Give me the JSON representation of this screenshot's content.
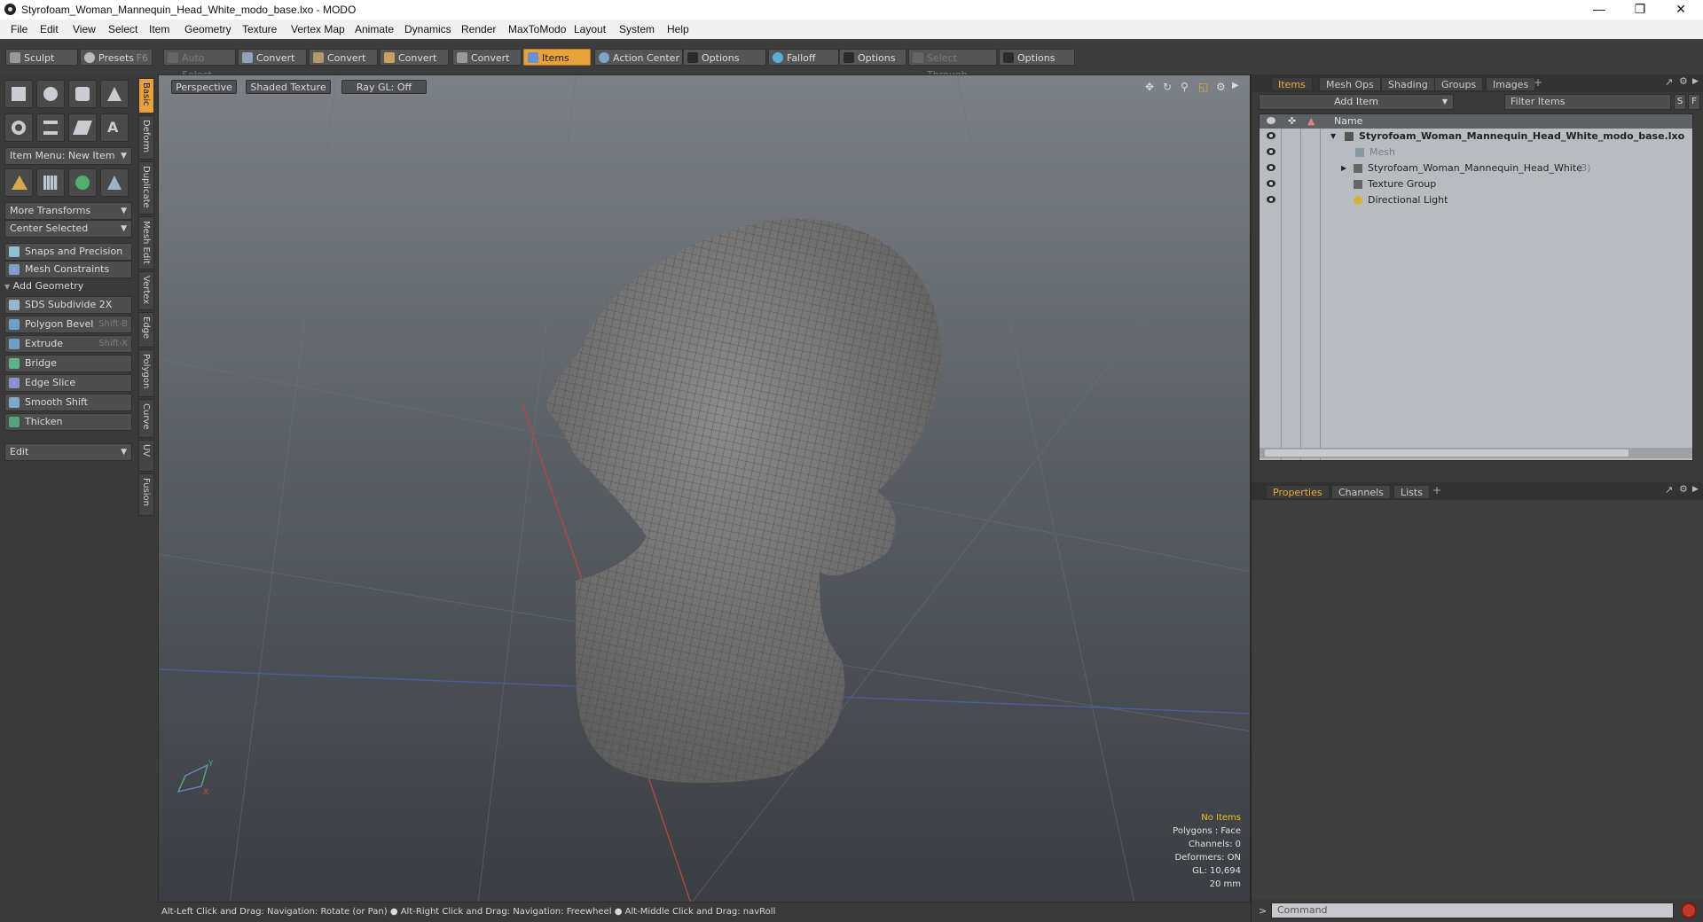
{
  "window": {
    "title": "Styrofoam_Woman_Mannequin_Head_White_modo_base.lxo - MODO"
  },
  "menu": [
    "File",
    "Edit",
    "View",
    "Select",
    "Item",
    "Geometry",
    "Texture",
    "Vertex Map",
    "Animate",
    "Dynamics",
    "Render",
    "MaxToModo",
    "Layout",
    "System",
    "Help"
  ],
  "toolbar": {
    "sculpt": "Sculpt",
    "presets": "Presets",
    "presets_key": "F6",
    "auto_select": "Auto Select",
    "convert1": "Convert",
    "convert2": "Convert",
    "convert3": "Convert",
    "convert4": "Convert",
    "items": "Items",
    "action_center": "Action Center",
    "options1": "Options",
    "falloff": "Falloff",
    "options2": "Options",
    "select_through": "Select Through",
    "options3": "Options"
  },
  "left": {
    "item_menu": "Item Menu: New Item",
    "more_transforms": "More Transforms",
    "center_selected": "Center Selected",
    "snaps": "Snaps and Precision",
    "mesh_constraints": "Mesh Constraints",
    "add_geometry": "Add Geometry",
    "sds": "SDS Subdivide 2X",
    "polygon_bevel": "Polygon Bevel",
    "polygon_bevel_key": "Shift-B",
    "extrude": "Extrude",
    "extrude_key": "Shift-X",
    "bridge": "Bridge",
    "edge_slice": "Edge Slice",
    "smooth_shift": "Smooth Shift",
    "thicken": "Thicken",
    "edit": "Edit",
    "side_tabs": [
      "Basic",
      "Deform",
      "Duplicate",
      "Mesh Edit",
      "Vertex",
      "Edge",
      "Polygon",
      "Curve",
      "UV",
      "Fusion"
    ]
  },
  "viewport": {
    "perspective": "Perspective",
    "shading": "Shaded Texture",
    "raygl": "Ray GL: Off",
    "info": {
      "no_items": "No Items",
      "polygons": "Polygons : Face",
      "channels": "Channels: 0",
      "deformers": "Deformers: ON",
      "gl": "GL: 10,694",
      "scale": "20 mm"
    },
    "axis_y": "Y",
    "axis_x": "X"
  },
  "status": "Alt-Left Click and Drag: Navigation: Rotate (or Pan) ●  Alt-Right Click and Drag: Navigation: Freewheel ●  Alt-Middle Click and Drag: navRoll",
  "items_panel": {
    "tabs": [
      "Items",
      "Mesh Ops",
      "Shading",
      "Groups",
      "Images"
    ],
    "add_item": "Add Item",
    "filter": "Filter Items",
    "filter_s": "S",
    "filter_f": "F",
    "col_name": "Name",
    "tree": [
      {
        "label": "Styrofoam_Woman_Mannequin_Head_White_modo_base.lxo"
      },
      {
        "label": "Mesh"
      },
      {
        "label": "Styrofoam_Woman_Mannequin_Head_White",
        "count": "(3)"
      },
      {
        "label": "Texture Group"
      },
      {
        "label": "Directional Light"
      }
    ]
  },
  "props_panel": {
    "tabs": [
      "Properties",
      "Channels",
      "Lists"
    ],
    "command_placeholder": "Command",
    "prompt": ">"
  },
  "colors": {
    "accent": "#e8a23c",
    "tree_bg": "#b8bcc1",
    "viewport_top": "#7c8187",
    "viewport_bottom": "#3a3e43"
  }
}
